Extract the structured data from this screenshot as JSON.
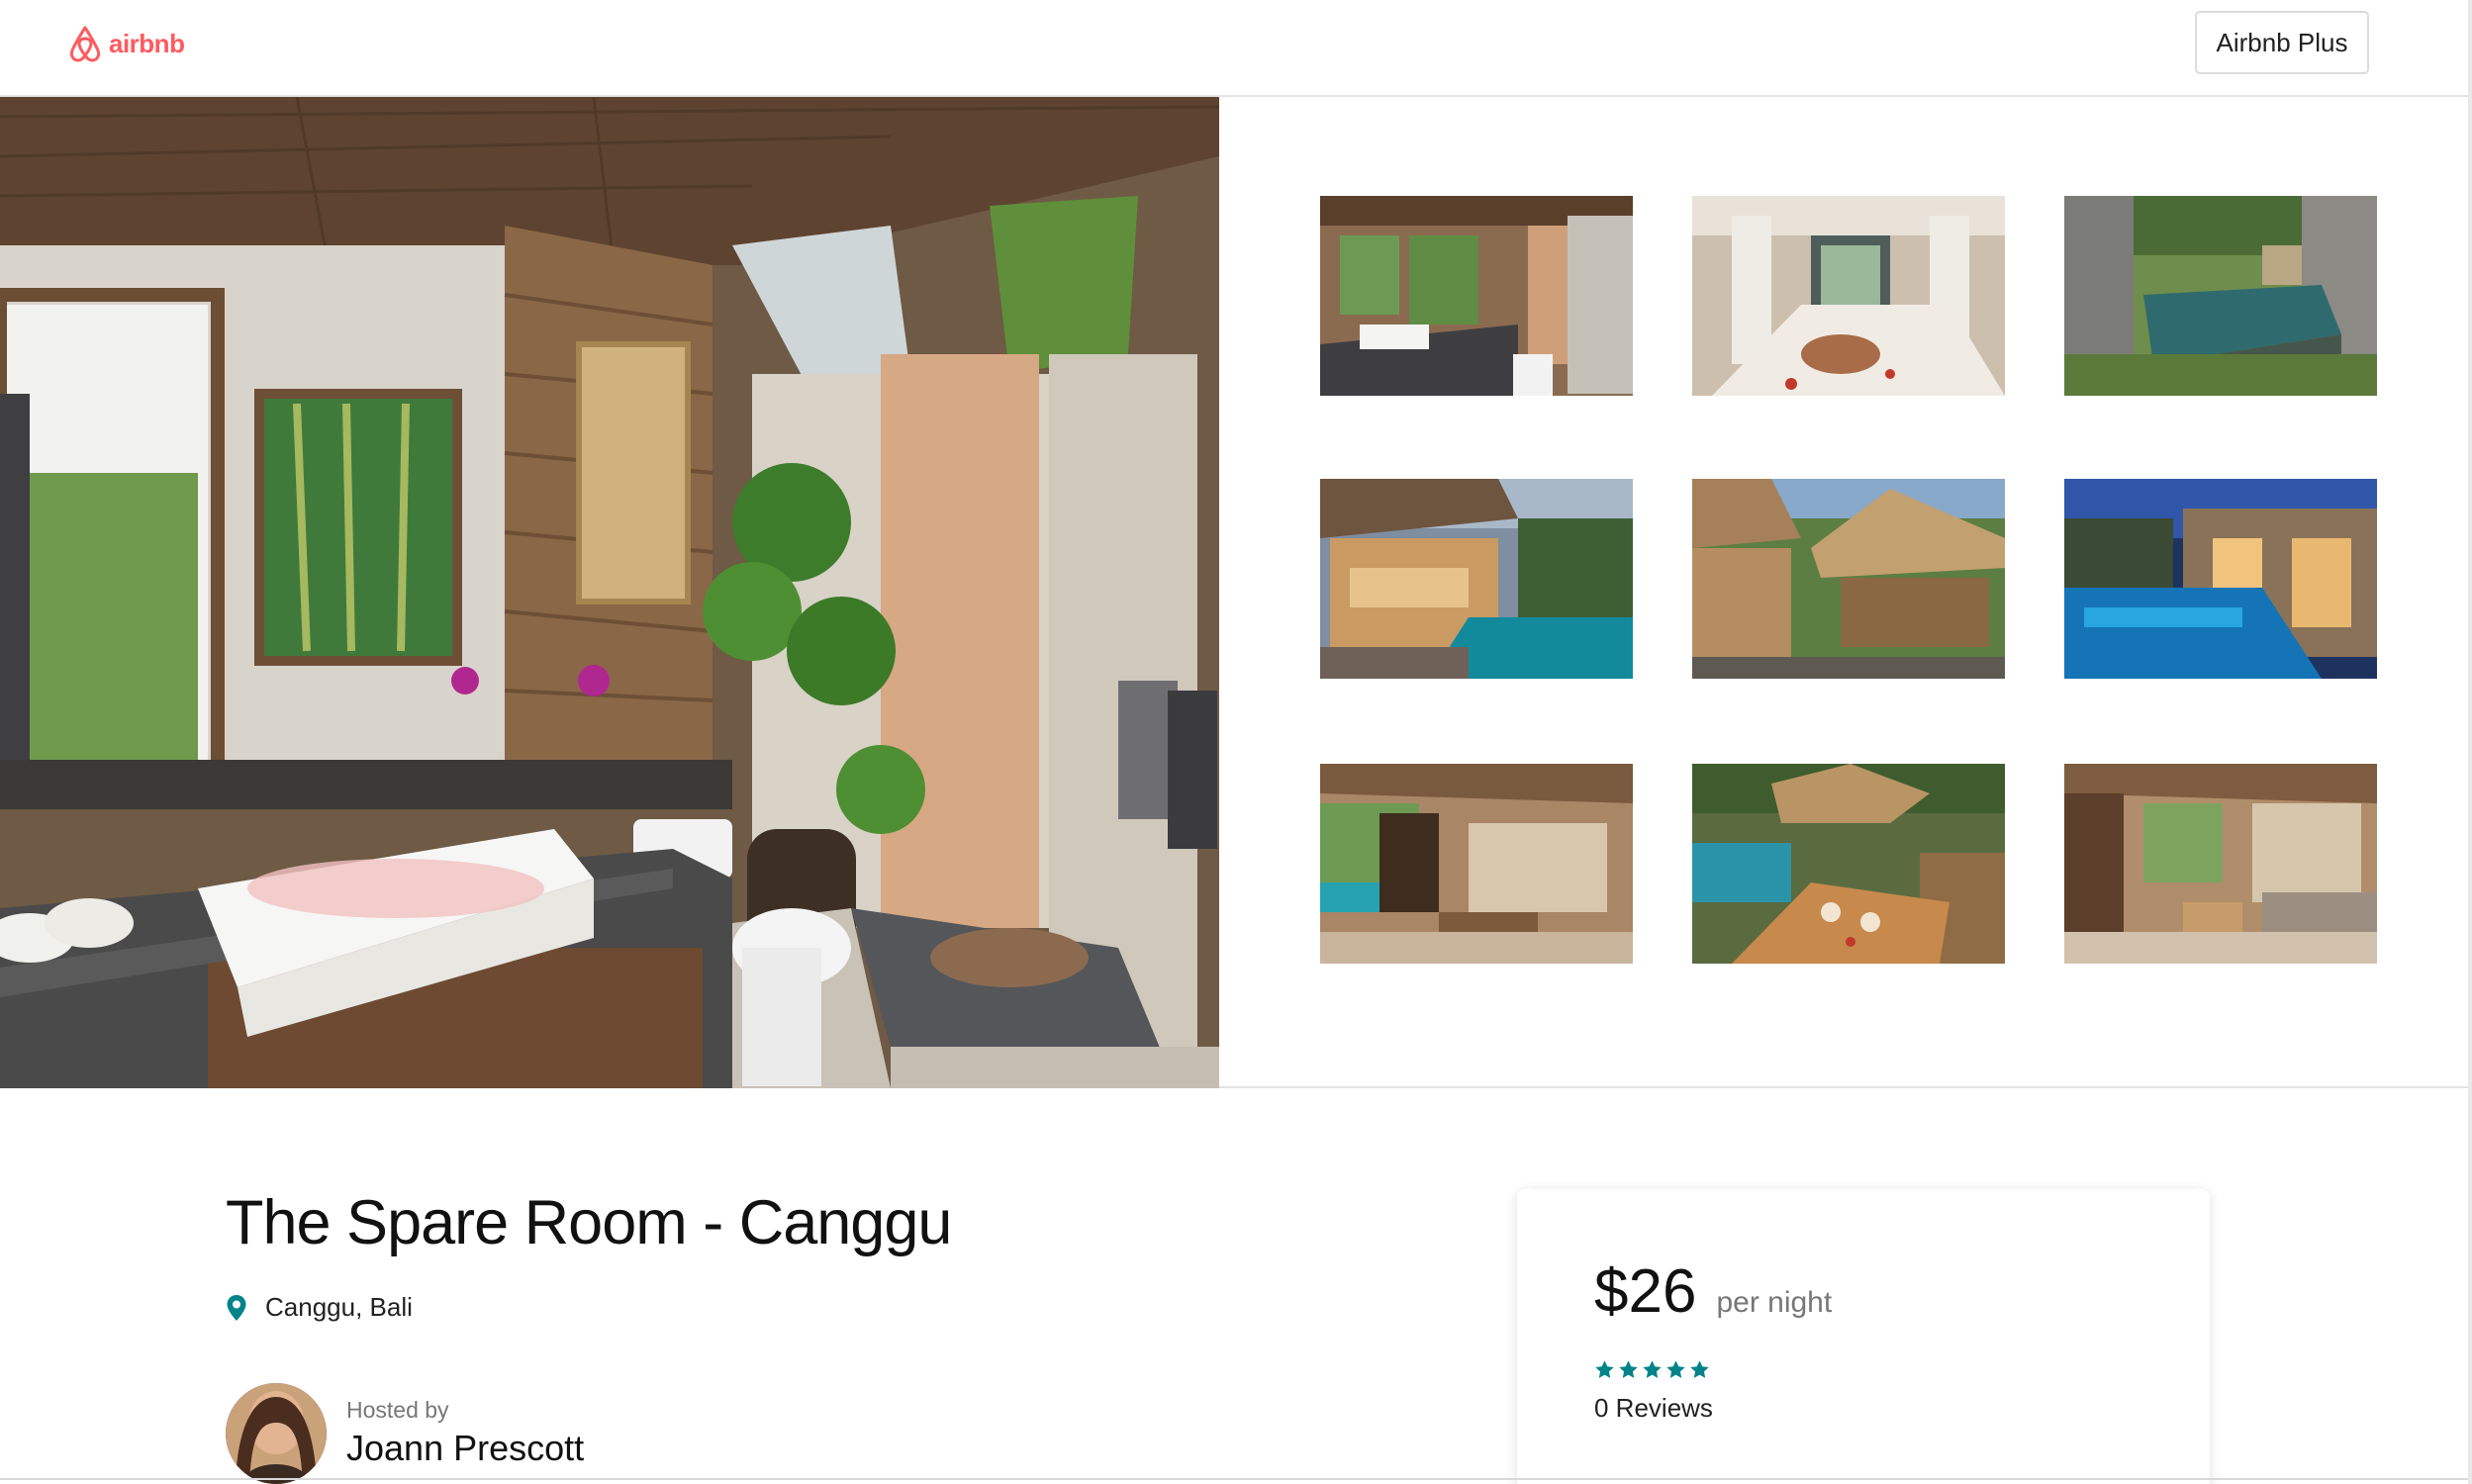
{
  "header": {
    "logo_text": "airbnb",
    "plus_button_label": "Airbnb Plus"
  },
  "gallery": {
    "hero_image": "bathroom with outdoor shower",
    "thumbnails": [
      {
        "name": "bathroom"
      },
      {
        "name": "bedroom"
      },
      {
        "name": "pool-garden"
      },
      {
        "name": "living-pool"
      },
      {
        "name": "gazebo-garden"
      },
      {
        "name": "pool-night"
      },
      {
        "name": "open-living-room"
      },
      {
        "name": "dining-table"
      },
      {
        "name": "lounge"
      }
    ]
  },
  "listing": {
    "title": "The Spare Room - Canggu",
    "location": "Canggu, Bali",
    "hosted_by_label": "Hosted by",
    "host_name": "Joann Prescott"
  },
  "booking": {
    "price": "$26",
    "per_night": "per night",
    "rating_stars": 5,
    "reviews": "0 Reviews"
  },
  "colors": {
    "brand": "#ff5a5f",
    "accent": "#008489"
  }
}
